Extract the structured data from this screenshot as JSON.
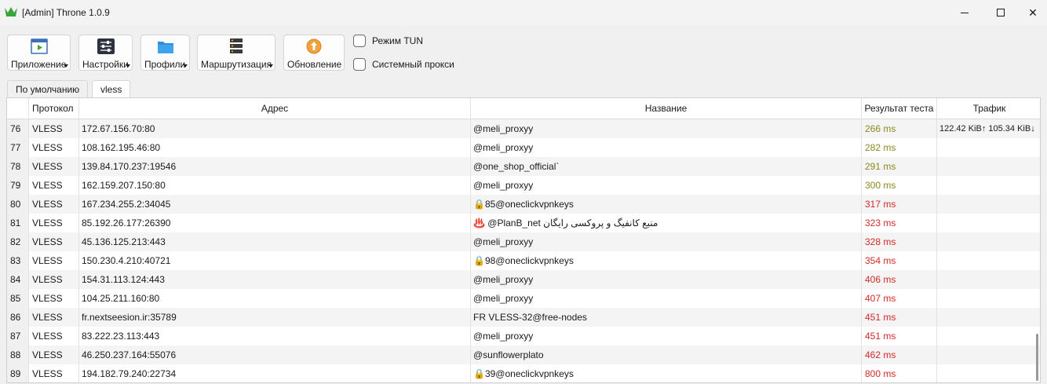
{
  "window": {
    "title": "[Admin] Throne 1.0.9",
    "brand_color": "#3aa63a"
  },
  "toolbar": {
    "buttons": [
      {
        "label": "Приложение",
        "icon": "app-window-icon"
      },
      {
        "label": "Настройки",
        "icon": "sliders-icon"
      },
      {
        "label": "Профили",
        "icon": "folder-icon"
      },
      {
        "label": "Маршрутизация",
        "icon": "server-icon"
      },
      {
        "label": "Обновление",
        "icon": "update-arrow-icon"
      }
    ],
    "checkboxes": [
      {
        "label": "Режим TUN",
        "checked": false
      },
      {
        "label": "Системный прокси",
        "checked": false
      }
    ]
  },
  "tabs": [
    {
      "label": "По умолчанию",
      "active": false
    },
    {
      "label": "vless",
      "active": true
    }
  ],
  "table": {
    "headers": {
      "protocol": "Протокол",
      "address": "Адрес",
      "name": "Название",
      "latency": "Результат теста",
      "traffic": "Трафик"
    },
    "rows": [
      {
        "idx": "76",
        "protocol": "VLESS",
        "address": "172.67.156.70:80",
        "name": "@meli_proxyy",
        "latency": "266 ms",
        "latency_color": "#8a8a1f",
        "traffic": "122.42 KiB↑ 105.34 KiB↓"
      },
      {
        "idx": "77",
        "protocol": "VLESS",
        "address": "108.162.195.46:80",
        "name": "@meli_proxyy",
        "latency": "282 ms",
        "latency_color": "#8a8a1f",
        "traffic": ""
      },
      {
        "idx": "78",
        "protocol": "VLESS",
        "address": "139.84.170.237:19546",
        "name": "@one_shop_official`",
        "latency": "291 ms",
        "latency_color": "#8a8a1f",
        "traffic": ""
      },
      {
        "idx": "79",
        "protocol": "VLESS",
        "address": "162.159.207.150:80",
        "name": "@meli_proxyy",
        "latency": "300 ms",
        "latency_color": "#8a8a1f",
        "traffic": ""
      },
      {
        "idx": "80",
        "protocol": "VLESS",
        "address": "167.234.255.2:34045",
        "name": "🔒85@oneclickvpnkeys",
        "latency": "317 ms",
        "latency_color": "#d42a2a",
        "traffic": ""
      },
      {
        "idx": "81",
        "protocol": "VLESS",
        "address": "85.192.26.177:26390",
        "name": "♨️ @PlanB_net منبع کانفیگ و پروکسی رایگان",
        "latency": "323 ms",
        "latency_color": "#d42a2a",
        "traffic": ""
      },
      {
        "idx": "82",
        "protocol": "VLESS",
        "address": "45.136.125.213:443",
        "name": "@meli_proxyy",
        "latency": "328 ms",
        "latency_color": "#d42a2a",
        "traffic": ""
      },
      {
        "idx": "83",
        "protocol": "VLESS",
        "address": "150.230.4.210:40721",
        "name": "🔒98@oneclickvpnkeys",
        "latency": "354 ms",
        "latency_color": "#d42a2a",
        "traffic": ""
      },
      {
        "idx": "84",
        "protocol": "VLESS",
        "address": "154.31.113.124:443",
        "name": "@meli_proxyy",
        "latency": "406 ms",
        "latency_color": "#d42a2a",
        "traffic": ""
      },
      {
        "idx": "85",
        "protocol": "VLESS",
        "address": "104.25.211.160:80",
        "name": "@meli_proxyy",
        "latency": "407 ms",
        "latency_color": "#d42a2a",
        "traffic": ""
      },
      {
        "idx": "86",
        "protocol": "VLESS",
        "address": "fr.nextseesion.ir:35789",
        "name": "FR VLESS-32@free-nodes",
        "latency": "451 ms",
        "latency_color": "#d42a2a",
        "traffic": ""
      },
      {
        "idx": "87",
        "protocol": "VLESS",
        "address": "83.222.23.113:443",
        "name": "@meli_proxyy",
        "latency": "451 ms",
        "latency_color": "#d42a2a",
        "traffic": ""
      },
      {
        "idx": "88",
        "protocol": "VLESS",
        "address": "46.250.237.164:55076",
        "name": "@sunflowerplato",
        "latency": "462 ms",
        "latency_color": "#d42a2a",
        "traffic": ""
      },
      {
        "idx": "89",
        "protocol": "VLESS",
        "address": "194.182.79.240:22734",
        "name": "🔒39@oneclickvpnkeys",
        "latency": "800 ms",
        "latency_color": "#d42a2a",
        "traffic": ""
      }
    ]
  }
}
